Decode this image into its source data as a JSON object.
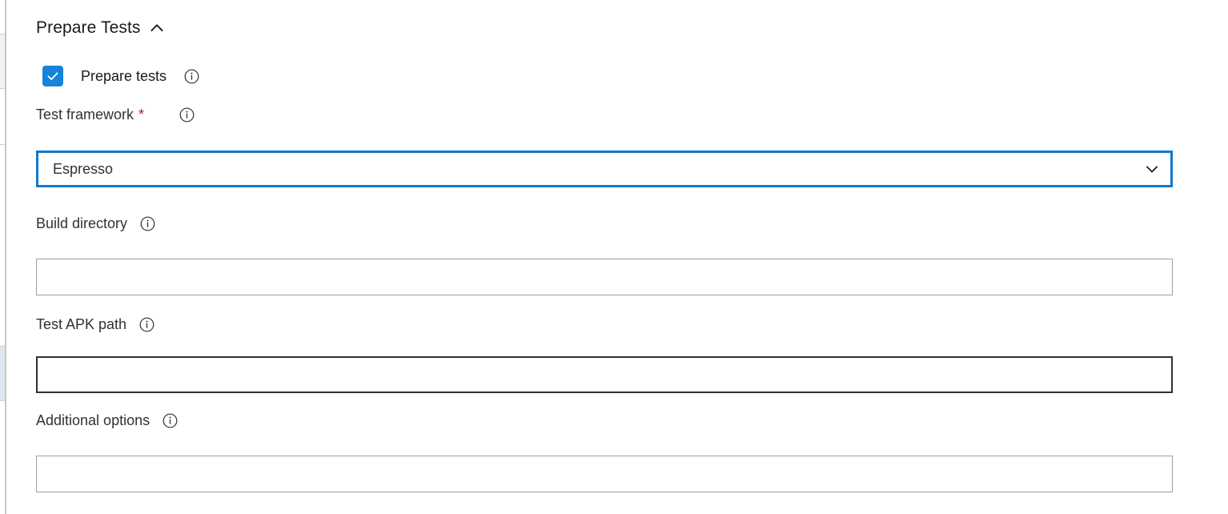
{
  "section": {
    "title": "Prepare Tests",
    "collapse_icon": "chevron-up-icon",
    "expanded": true
  },
  "checkbox": {
    "label": "Prepare tests",
    "checked": true,
    "info_icon": "info-icon",
    "accent_color": "#1683d8"
  },
  "fields": [
    {
      "key": "test_framework",
      "label": "Test framework",
      "required": true,
      "required_marker": "*",
      "required_color": "#a4262c",
      "info_icon": "info-icon",
      "control": "dropdown",
      "value": "Espresso",
      "placeholder": "",
      "focused": true,
      "focus_color": "#1278cc",
      "chevron_icon": "chevron-down-icon"
    },
    {
      "key": "build_directory",
      "label": "Build directory",
      "required": false,
      "info_icon": "info-icon",
      "control": "text",
      "value": "",
      "placeholder": "",
      "focused": false,
      "border_color": "#a19f9d"
    },
    {
      "key": "test_apk_path",
      "label": "Test APK path",
      "required": false,
      "info_icon": "info-icon",
      "control": "text",
      "value": "",
      "placeholder": "",
      "hovered": true,
      "border_color": "#323130"
    },
    {
      "key": "additional_options",
      "label": "Additional options",
      "required": false,
      "info_icon": "info-icon",
      "control": "text",
      "value": "",
      "placeholder": "",
      "focused": false,
      "border_color": "#a19f9d"
    }
  ]
}
